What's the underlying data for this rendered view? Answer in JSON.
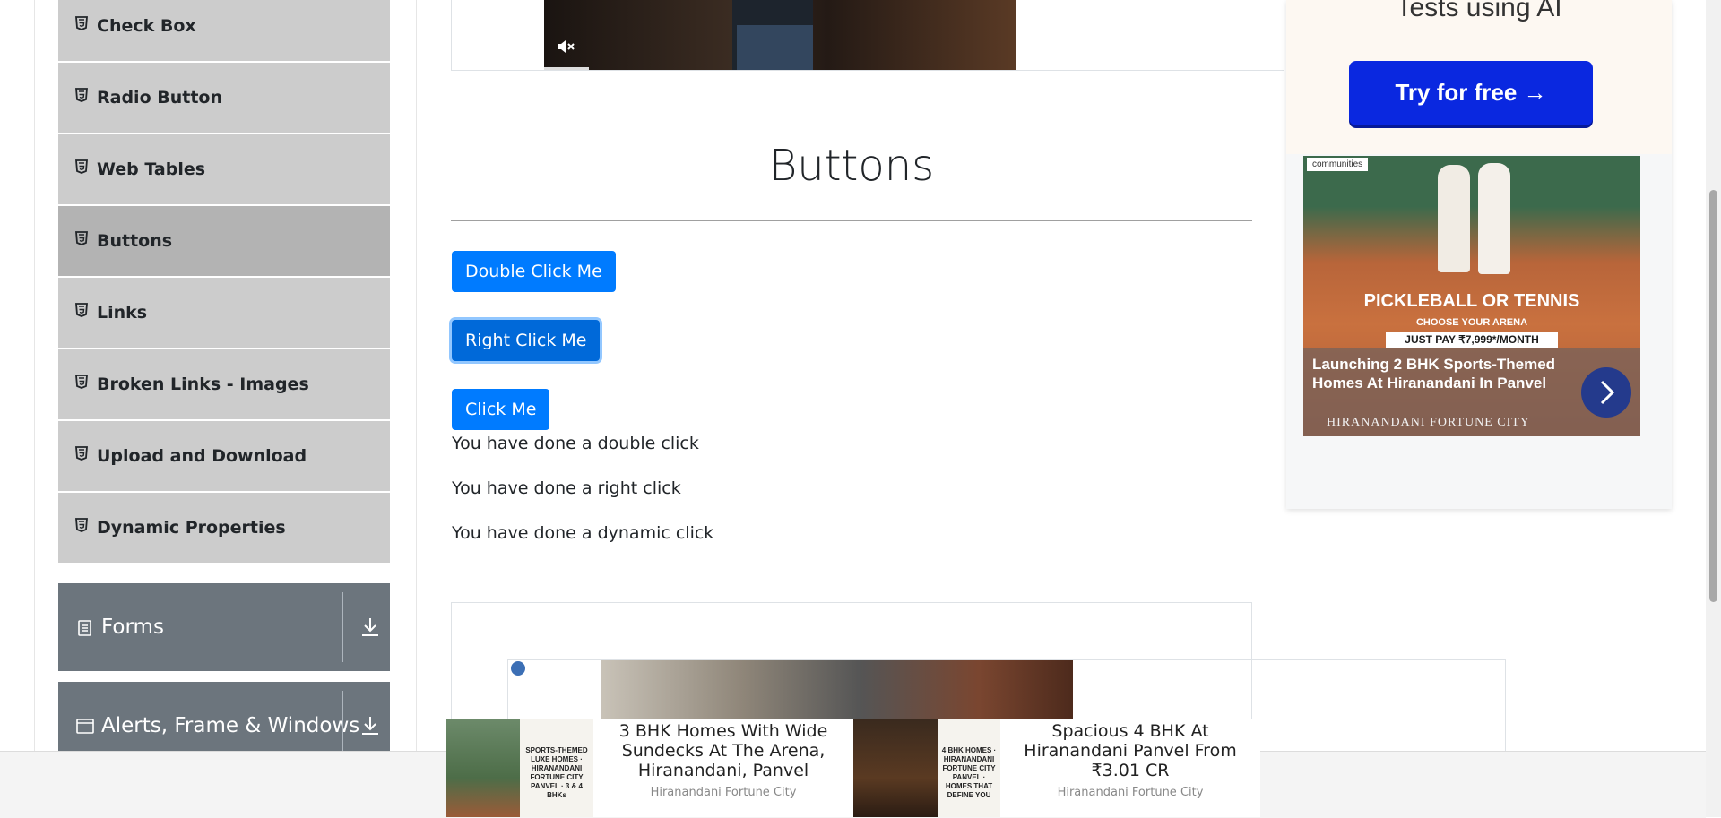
{
  "sidebar": {
    "elements_items": [
      {
        "label": "Check Box",
        "active": false
      },
      {
        "label": "Radio Button",
        "active": false
      },
      {
        "label": "Web Tables",
        "active": false
      },
      {
        "label": "Buttons",
        "active": true
      },
      {
        "label": "Links",
        "active": false
      },
      {
        "label": "Broken Links - Images",
        "active": false
      },
      {
        "label": "Upload and Download",
        "active": false
      },
      {
        "label": "Dynamic Properties",
        "active": false
      }
    ],
    "groups": [
      {
        "label": "Forms",
        "icon": "document-icon"
      },
      {
        "label": "Alerts, Frame & Windows",
        "icon": "window-icon"
      }
    ]
  },
  "main": {
    "title": "Buttons",
    "buttons": {
      "double_click": "Double Click Me",
      "right_click": "Right Click Me",
      "click": "Click Me"
    },
    "messages": {
      "double": "You have done a double click",
      "right": "You have done a right click",
      "dynamic": "You have done a dynamic click"
    }
  },
  "right_ad": {
    "top_title": "Tests using AI",
    "cta": "Try for free →",
    "brand": "communities",
    "headline": "PICKLEBALL OR TENNIS",
    "subheadline": "CHOOSE YOUR ARENA",
    "price": "JUST PAY ₹7,999*/MONTH",
    "description": "Launching 2 BHK Sports-Themed Homes At Hiranandani In Panvel",
    "footer": "HIRANANDANI FORTUNE CITY"
  },
  "bottom_ad": {
    "cards": [
      {
        "thumb_text": "SPORTS-THEMED LUXE HOMES · HIRANANDANI FORTUNE CITY PANVEL · 3 & 4 BHKs",
        "title": "3 BHK Homes With Wide Sundecks At The Arena, Hiranandani, Panvel",
        "source": "Hiranandani Fortune City"
      },
      {
        "thumb_text": "4 BHK HOMES · HIRANANDANI FORTUNE CITY PANVEL · HOMES THAT DEFINE YOU",
        "title": "Spacious 4 BHK At Hiranandani Panvel From ₹3.01 CR",
        "source": "Hiranandani Fortune City"
      }
    ]
  },
  "colors": {
    "primary": "#007bff",
    "sidebar_item": "#cccccc",
    "sidebar_active": "#b3b3b3",
    "group_header": "#6c757d",
    "ad_cta": "#0a28e0"
  }
}
